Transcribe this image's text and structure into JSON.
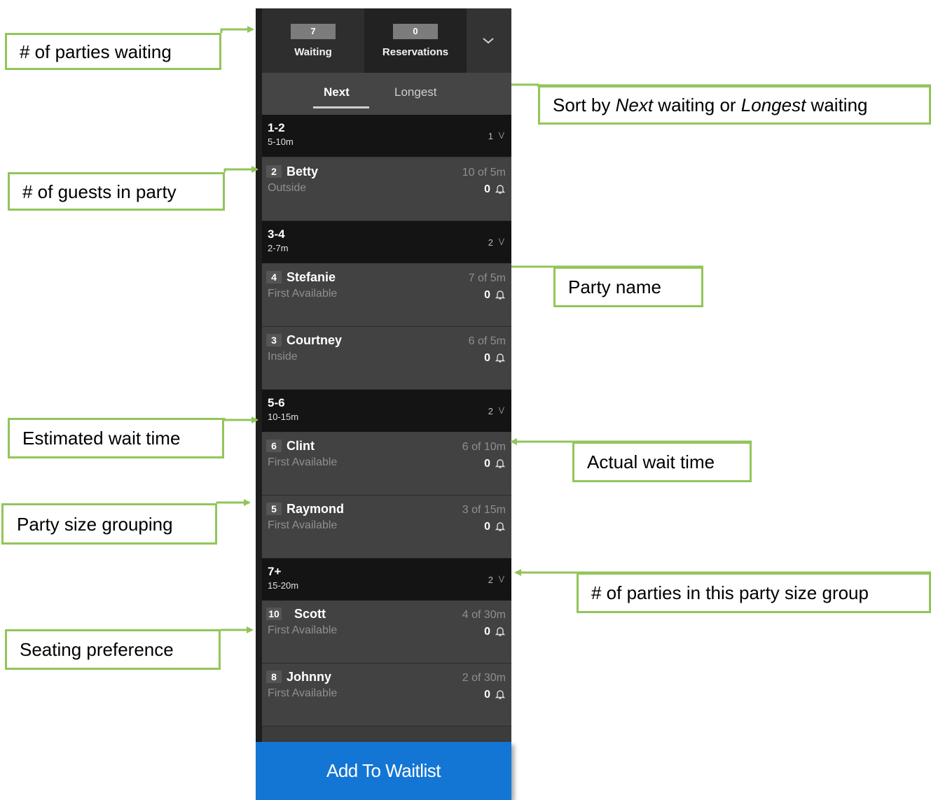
{
  "header": {
    "waiting_count": "7",
    "waiting_label": "Waiting",
    "reservations_count": "0",
    "reservations_label": "Reservations"
  },
  "sort": {
    "next_label": "Next",
    "longest_label": "Longest"
  },
  "groups": [
    {
      "name": "1-2",
      "wait": "5-10m",
      "count": "1",
      "parties": [
        {
          "size": "2",
          "name": "Betty",
          "pref": "Outside",
          "wait": "10 of 5m",
          "notif": "0"
        }
      ]
    },
    {
      "name": "3-4",
      "wait": "2-7m",
      "count": "2",
      "parties": [
        {
          "size": "4",
          "name": "Stefanie",
          "pref": "First Available",
          "wait": "7 of 5m",
          "notif": "0"
        },
        {
          "size": "3",
          "name": "Courtney",
          "pref": "Inside",
          "wait": "6 of 5m",
          "notif": "0"
        }
      ]
    },
    {
      "name": "5-6",
      "wait": "10-15m",
      "count": "2",
      "parties": [
        {
          "size": "6",
          "name": "Clint",
          "pref": "First Available",
          "wait": "6 of 10m",
          "notif": "0"
        },
        {
          "size": "5",
          "name": "Raymond",
          "pref": "First Available",
          "wait": "3 of 15m",
          "notif": "0"
        }
      ]
    },
    {
      "name": "7+",
      "wait": "15-20m",
      "count": "2",
      "parties": [
        {
          "size": "10",
          "name": "Scott",
          "pref": "First Available",
          "wait": "4 of 30m",
          "notif": "0"
        },
        {
          "size": "8",
          "name": "Johnny",
          "pref": "First Available",
          "wait": "2 of 30m",
          "notif": "0"
        }
      ]
    }
  ],
  "add_button": "Add To Waitlist",
  "callouts": {
    "parties_waiting": "# of parties waiting",
    "sort_pre": "Sort by ",
    "sort_next": "Next",
    "sort_mid": " waiting or ",
    "sort_longest": "Longest",
    "sort_post": " waiting",
    "guests_in_party": "# of guests in party",
    "party_name": "Party name",
    "estimated_wait": "Estimated wait time",
    "actual_wait": "Actual wait time",
    "party_size_grouping": "Party size grouping",
    "parties_in_group": "# of parties in this party size group",
    "seating_pref": "Seating preference"
  },
  "colors": {
    "callout_border": "#92c559",
    "button_blue": "#1476d4"
  }
}
